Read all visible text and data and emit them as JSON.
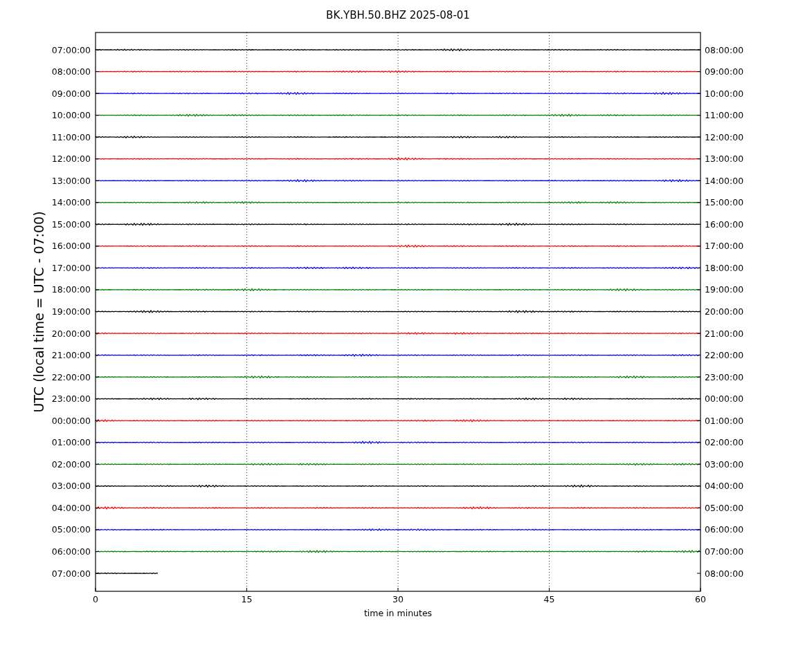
{
  "title": "BK.YBH.50.BHZ 2025-08-01",
  "ylabel": "UTC (local time = UTC - 07:00)",
  "xlabel": "time in minutes",
  "xticks": [
    "0",
    "15",
    "30",
    "45",
    "60"
  ],
  "rows": [
    {
      "left": "07:00:00",
      "right": "08:00:00",
      "color": "#000000",
      "level": 1
    },
    {
      "left": "08:00:00",
      "right": "09:00:00",
      "color": "#ff0000",
      "level": 1
    },
    {
      "left": "09:00:00",
      "right": "10:00:00",
      "color": "#0000ff",
      "level": 1
    },
    {
      "left": "10:00:00",
      "right": "11:00:00",
      "color": "#008000",
      "level": 1
    },
    {
      "left": "11:00:00",
      "right": "12:00:00",
      "color": "#000000",
      "level": 1
    },
    {
      "left": "12:00:00",
      "right": "13:00:00",
      "color": "#ff0000",
      "level": 1
    },
    {
      "left": "13:00:00",
      "right": "14:00:00",
      "color": "#0000ff",
      "level": 1
    },
    {
      "left": "14:00:00",
      "right": "15:00:00",
      "color": "#008000",
      "level": 1
    },
    {
      "left": "15:00:00",
      "right": "16:00:00",
      "color": "#000000",
      "level": 1
    },
    {
      "left": "16:00:00",
      "right": "17:00:00",
      "color": "#ff0000",
      "level": 1
    },
    {
      "left": "17:00:00",
      "right": "18:00:00",
      "color": "#0000ff",
      "level": 1
    },
    {
      "left": "18:00:00",
      "right": "19:00:00",
      "color": "#008000",
      "level": 1
    },
    {
      "left": "19:00:00",
      "right": "20:00:00",
      "color": "#000000",
      "level": 1
    },
    {
      "left": "20:00:00",
      "right": "21:00:00",
      "color": "#ff0000",
      "level": 1
    },
    {
      "left": "21:00:00",
      "right": "22:00:00",
      "color": "#0000ff",
      "level": 1
    },
    {
      "left": "22:00:00",
      "right": "23:00:00",
      "color": "#008000",
      "level": 1
    },
    {
      "left": "23:00:00",
      "right": "00:00:00",
      "color": "#000000",
      "level": 1
    },
    {
      "left": "00:00:00",
      "right": "01:00:00",
      "color": "#ff0000",
      "level": 1
    },
    {
      "left": "01:00:00",
      "right": "02:00:00",
      "color": "#0000ff",
      "level": 1
    },
    {
      "left": "02:00:00",
      "right": "03:00:00",
      "color": "#008000",
      "level": 1
    },
    {
      "left": "03:00:00",
      "right": "04:00:00",
      "color": "#000000",
      "level": 1
    },
    {
      "left": "04:00:00",
      "right": "05:00:00",
      "color": "#ff0000",
      "level": 1
    },
    {
      "left": "05:00:00",
      "right": "06:00:00",
      "color": "#0000ff",
      "level": 1
    },
    {
      "left": "06:00:00",
      "right": "07:00:00",
      "color": "#008000",
      "level": 1
    },
    {
      "left": "07:00:00",
      "right": "08:00:00",
      "color": "#000000",
      "level": 0.105
    }
  ]
}
